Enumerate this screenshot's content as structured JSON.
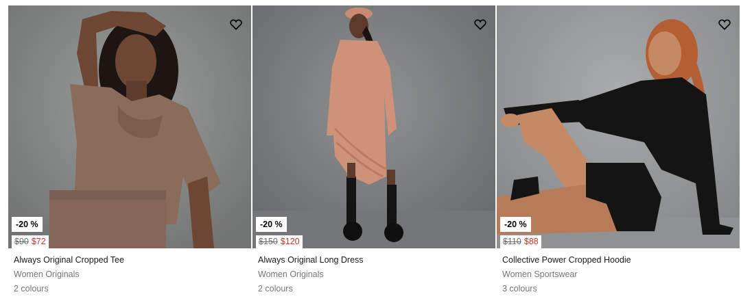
{
  "products": [
    {
      "name": "Always Original Cropped Tee",
      "category": "Women Originals",
      "colours": "2 colours",
      "badge": "-20 %",
      "original_price": "$90",
      "sale_price": "$72",
      "wishlist_icon": "heart-outline-icon",
      "image": {
        "subject": "model-brown-tee",
        "colors": {
          "bg": "#8a8c8c",
          "garment": "#8a6c5a",
          "skin": "#6e4734",
          "hair": "#1d1512"
        }
      }
    },
    {
      "name": "Always Original Long Dress",
      "category": "Women Originals",
      "colours": "2 colours",
      "badge": "-20 %",
      "original_price": "$150",
      "sale_price": "$120",
      "wishlist_icon": "heart-outline-icon",
      "image": {
        "subject": "model-peach-dress",
        "colors": {
          "bg": "#7c7e7f",
          "garment": "#cf9178",
          "skin": "#5b3a2c",
          "hair": "#1a1210"
        }
      }
    },
    {
      "name": "Collective Power Cropped Hoodie",
      "category": "Women Sportswear",
      "colours": "3 colours",
      "badge": "-20 %",
      "original_price": "$110",
      "sale_price": "$88",
      "wishlist_icon": "heart-outline-icon",
      "image": {
        "subject": "model-black-hoodie",
        "colors": {
          "bg": "#9b9d9e",
          "garment": "#141414",
          "skin": "#c58a64",
          "hair": "#b45e34"
        }
      }
    }
  ]
}
